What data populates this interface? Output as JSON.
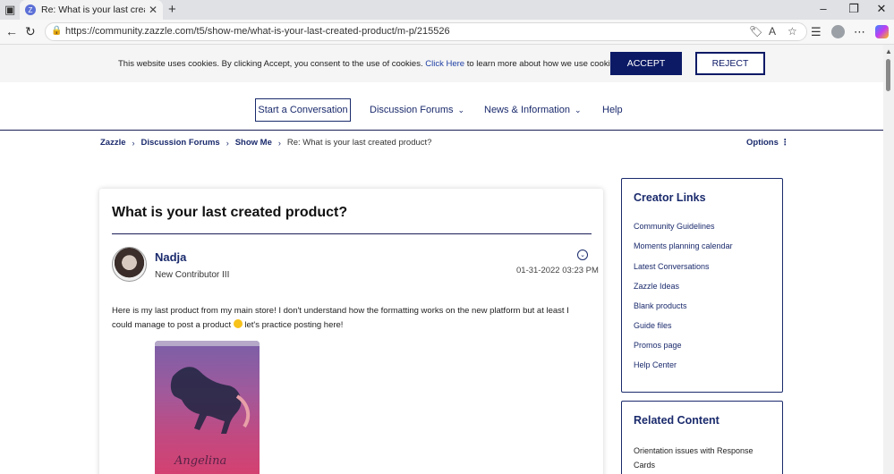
{
  "browser": {
    "tab_title": "Re: What is your last created produ",
    "url": "https://community.zazzle.com/t5/show-me/what-is-your-last-created-product/m-p/215526"
  },
  "cookie_banner": {
    "text_before": "This website uses cookies. By clicking Accept, you consent to the use of cookies.",
    "link_text": "Click Here",
    "text_after": "to learn more about how we use cookies.",
    "accept_label": "ACCEPT",
    "reject_label": "REJECT"
  },
  "nav": {
    "start_conversation": "Start a Conversation",
    "discussion_forums": "Discussion Forums",
    "news_information": "News & Information",
    "help": "Help"
  },
  "breadcrumb": {
    "items": [
      "Zazzle",
      "Discussion Forums",
      "Show Me"
    ],
    "current": "Re: What is your last created product?",
    "options_label": "Options"
  },
  "post": {
    "title": "What is your last created product?",
    "author": "Nadja",
    "rank": "New Contributor III",
    "date": "01-31-2022 03:23 PM",
    "body_1": "Here is my last product from my main store! I don't understand how the formatting works on the new platform but at least I could manage to post a product",
    "body_2": "let's practice posting here!",
    "image_text": "Angelina"
  },
  "sidebar": {
    "creator_title": "Creator Links",
    "links": [
      "Community Guidelines",
      "Moments planning calendar",
      "Latest Conversations",
      "Zazzle Ideas",
      "Blank products",
      "Guide files",
      "Promos page",
      "Help Center"
    ],
    "related_title": "Related Content",
    "related_item": "Orientation issues with Response Cards"
  }
}
